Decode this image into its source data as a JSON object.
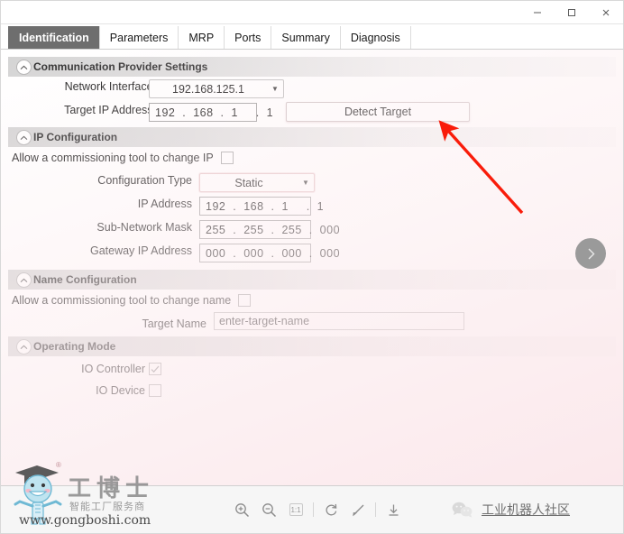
{
  "window": {
    "controls": [
      {
        "name": "minimize",
        "glyph": "minimize-icon"
      },
      {
        "name": "maximize",
        "glyph": "maximize-icon"
      },
      {
        "name": "close",
        "glyph": "close-icon"
      }
    ]
  },
  "tabs": [
    {
      "label": "Identification",
      "active": true
    },
    {
      "label": "Parameters",
      "active": false
    },
    {
      "label": "MRP",
      "active": false
    },
    {
      "label": "Ports",
      "active": false
    },
    {
      "label": "Summary",
      "active": false
    },
    {
      "label": "Diagnosis",
      "active": false
    }
  ],
  "sections": {
    "communication": {
      "title": "Communication Provider Settings",
      "network_interface_label": "Network Interface:",
      "network_interface_value": "192.168.125.1",
      "target_ip_label": "Target IP Address:",
      "target_ip_value": "192  .  168  .  1     .  1",
      "detect_button": "Detect Target"
    },
    "ip_configuration": {
      "title": "IP Configuration",
      "allow_change_label": "Allow a commissioning tool to change IP",
      "allow_change_checked": false,
      "config_type_label": "Configuration Type",
      "config_type_value": "Static",
      "ip_address_label": "IP Address",
      "ip_address_value": "192  .  168  .  1     .  1",
      "subnet_label": "Sub-Network Mask",
      "subnet_value": "255  .  255  .  255  .  000",
      "gateway_label": "Gateway IP Address",
      "gateway_value": "000  .  000  .  000  .  000"
    },
    "name_configuration": {
      "title": "Name Configuration",
      "allow_change_label": "Allow a commissioning tool to change name",
      "allow_change_checked": false,
      "target_name_label": "Target Name",
      "target_name_value": "enter-target-name"
    },
    "operating_mode": {
      "title": "Operating Mode",
      "io_controller_label": "IO Controller",
      "io_controller_checked": true,
      "io_device_label": "IO Device",
      "io_device_checked": false
    }
  },
  "next_button": {
    "name": "next-page-button",
    "glyph": "chevron-right-icon"
  },
  "annotation": {
    "color": "#f91c0a",
    "type": "arrow"
  },
  "bottom_toolbar": {
    "tools": [
      {
        "name": "zoom-in-icon",
        "label": "Zoom In"
      },
      {
        "name": "zoom-out-icon",
        "label": "Zoom Out"
      },
      {
        "name": "actual-size-icon",
        "label": "1:1"
      },
      {
        "name": "rotate-icon",
        "label": "Rotate"
      },
      {
        "name": "edit-icon",
        "label": "Edit"
      },
      {
        "name": "download-icon",
        "label": "Download"
      }
    ],
    "actual_size_text": "1:1",
    "wechat_label": "工业机器人社区"
  },
  "watermark": {
    "brand_cn": "工博士",
    "tagline": "智能工厂服务商",
    "url": "www.gongboshi.com",
    "registered": "®"
  },
  "colors": {
    "tab_active_bg": "#6e6e6e",
    "section_head_left": "#d4d4d4",
    "arrow_red": "#f91c0a",
    "next_button_bg": "#9a9a9a"
  }
}
